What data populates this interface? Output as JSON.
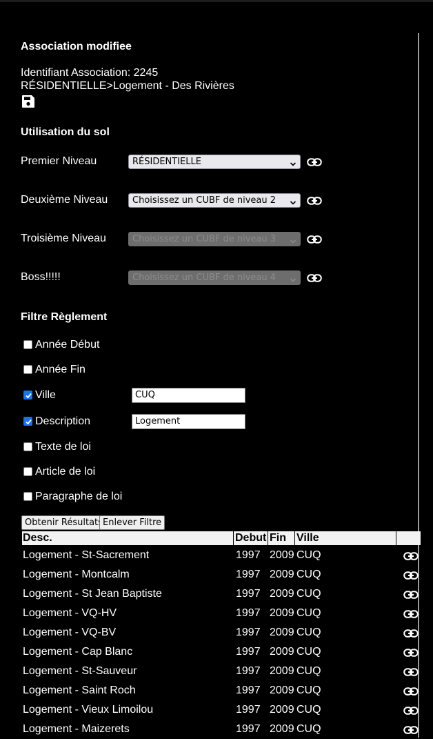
{
  "association": {
    "title": "Association modifiee",
    "id_line": "Identifiant Association: 2245",
    "path_line": "RÉSIDENTIELLE>Logement - Des Rivières"
  },
  "landuse": {
    "title": "Utilisation du sol",
    "levels": [
      {
        "label": "Premier Niveau",
        "value": "RÉSIDENTIELLE",
        "disabled": false
      },
      {
        "label": "Deuxième Niveau",
        "value": "Choisissez un CUBF de niveau 2",
        "disabled": false
      },
      {
        "label": "Troisième Niveau",
        "value": "Choisissez un CUBF de niveau 3",
        "disabled": true
      },
      {
        "label": "Boss!!!!!",
        "value": "Choisissez un CUBF de niveau 4",
        "disabled": true
      }
    ]
  },
  "filter": {
    "title": "Filtre Règlement",
    "items": [
      {
        "label": "Année Début",
        "checked": false,
        "value": null
      },
      {
        "label": "Année Fin",
        "checked": false,
        "value": null
      },
      {
        "label": "Ville",
        "checked": true,
        "value": "CUQ"
      },
      {
        "label": "Description",
        "checked": true,
        "value": "Logement"
      },
      {
        "label": "Texte de loi",
        "checked": false,
        "value": null
      },
      {
        "label": "Article de loi",
        "checked": false,
        "value": null
      },
      {
        "label": "Paragraphe de loi",
        "checked": false,
        "value": null
      }
    ],
    "get_results_label": "Obtenir Résultats",
    "clear_filter_label": "Enlever Filtre"
  },
  "table": {
    "headers": {
      "desc": "Desc.",
      "debut": "Debut",
      "fin": "Fin",
      "ville": "Ville"
    },
    "rows": [
      {
        "desc": "Logement - St-Sacrement",
        "debut": "1997",
        "fin": "2009",
        "ville": "CUQ"
      },
      {
        "desc": "Logement - Montcalm",
        "debut": "1997",
        "fin": "2009",
        "ville": "CUQ"
      },
      {
        "desc": "Logement - St Jean Baptiste",
        "debut": "1997",
        "fin": "2009",
        "ville": "CUQ"
      },
      {
        "desc": "Logement - VQ-HV",
        "debut": "1997",
        "fin": "2009",
        "ville": "CUQ"
      },
      {
        "desc": "Logement - VQ-BV",
        "debut": "1997",
        "fin": "2009",
        "ville": "CUQ"
      },
      {
        "desc": "Logement - Cap Blanc",
        "debut": "1997",
        "fin": "2009",
        "ville": "CUQ"
      },
      {
        "desc": "Logement - St-Sauveur",
        "debut": "1997",
        "fin": "2009",
        "ville": "CUQ"
      },
      {
        "desc": "Logement - Saint Roch",
        "debut": "1997",
        "fin": "2009",
        "ville": "CUQ"
      },
      {
        "desc": "Logement - Vieux Limoilou",
        "debut": "1997",
        "fin": "2009",
        "ville": "CUQ"
      },
      {
        "desc": "Logement - Maizerets",
        "debut": "1997",
        "fin": "2009",
        "ville": "CUQ"
      }
    ]
  },
  "icons": {
    "save": "save-icon",
    "link": "link-icon",
    "dropdown": "chevron-down-icon"
  },
  "colors": {
    "background": "#000000",
    "checkbox_checked": "#1a73e8",
    "table_header": "#f2f2f2"
  }
}
